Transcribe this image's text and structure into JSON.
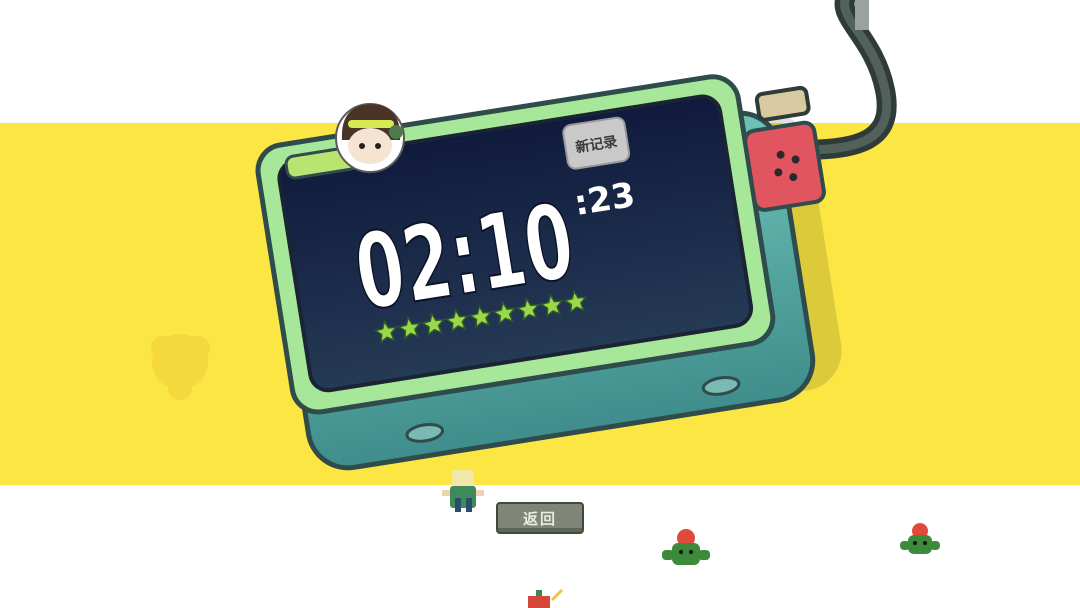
{
  "timer": {
    "main_time": "02:10",
    "seconds": ":23",
    "badge": "新记录",
    "stars_earned": 9
  },
  "back_button": {
    "label": "返回"
  },
  "colors": {
    "band": "#fbe643",
    "screen": "#17254a",
    "device_body": "#5fb3ab",
    "device_rim": "#a6e79a",
    "star": "#9ad84a"
  }
}
